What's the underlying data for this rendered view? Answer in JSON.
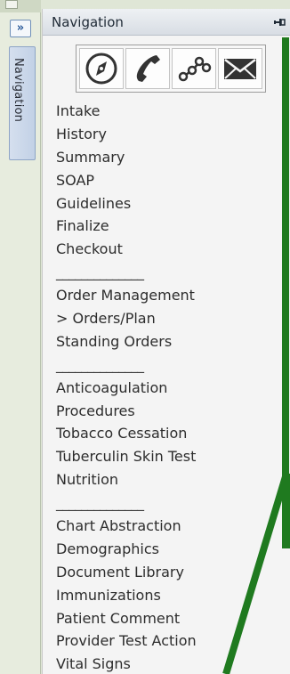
{
  "rail": {
    "expand_label": "»",
    "tab_label": "Navigation"
  },
  "panel": {
    "title": "Navigation",
    "toolbar": [
      {
        "name": "compass-icon"
      },
      {
        "name": "phone-icon"
      },
      {
        "name": "workflow-icon"
      },
      {
        "name": "envelope-icon"
      }
    ],
    "items": [
      {
        "label": "Intake",
        "type": "link"
      },
      {
        "label": "History",
        "type": "link"
      },
      {
        "label": "Summary",
        "type": "link"
      },
      {
        "label": "SOAP",
        "type": "link"
      },
      {
        "label": "Guidelines",
        "type": "link"
      },
      {
        "label": "Finalize",
        "type": "link"
      },
      {
        "label": "Checkout",
        "type": "link"
      },
      {
        "label": "______________",
        "type": "sep"
      },
      {
        "label": "Order Management",
        "type": "link"
      },
      {
        "label": "> Orders/Plan",
        "type": "link"
      },
      {
        "label": "Standing Orders",
        "type": "link"
      },
      {
        "label": "______________",
        "type": "sep"
      },
      {
        "label": "Anticoagulation",
        "type": "link"
      },
      {
        "label": "Procedures",
        "type": "link"
      },
      {
        "label": "Tobacco Cessation",
        "type": "link"
      },
      {
        "label": "Tuberculin Skin Test",
        "type": "link"
      },
      {
        "label": "Nutrition",
        "type": "link"
      },
      {
        "label": "______________",
        "type": "sep"
      },
      {
        "label": "Chart Abstraction",
        "type": "link"
      },
      {
        "label": "Demographics",
        "type": "link"
      },
      {
        "label": "Document Library",
        "type": "link"
      },
      {
        "label": "Immunizations",
        "type": "link"
      },
      {
        "label": "Patient Comment",
        "type": "link"
      },
      {
        "label": "Provider Test Action",
        "type": "link"
      },
      {
        "label": "Vital Signs",
        "type": "link"
      }
    ]
  },
  "colors": {
    "annotation_line": "#1f7a1f",
    "accent": "#2c5b9a"
  }
}
